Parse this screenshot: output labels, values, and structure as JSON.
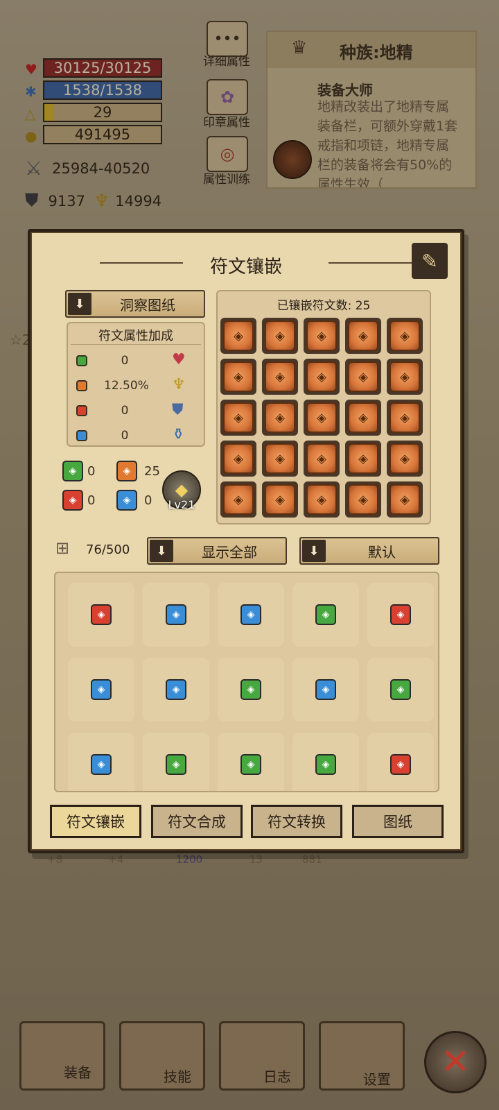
{
  "stats": {
    "hp": "30125/30125",
    "mp": "1538/1538",
    "level": "29",
    "gold": "491495",
    "attack": "25984-40520",
    "defense": "9137",
    "power": "14994"
  },
  "top_buttons": {
    "detail": "详细属性",
    "seal": "印章属性",
    "training": "属性训练"
  },
  "race": {
    "title": "种族:地精",
    "skill_name": "装备大师",
    "desc": "地精改装出了地精专属装备栏，可额外穿戴1套戒指和项链，地精专属栏的装备将会有50%的属性生效（"
  },
  "background_hint": {
    "star": "2"
  },
  "panel": {
    "title": "符文镶嵌",
    "blueprint_dropdown": "洞察图纸",
    "bonus_title": "符文属性加成",
    "bonuses": [
      {
        "color": "#48a840",
        "value": "0",
        "icon": "heart-icon"
      },
      {
        "color": "#e07a30",
        "value": "12.50%",
        "icon": "key-icon"
      },
      {
        "color": "#d84030",
        "value": "0",
        "icon": "shield-icon"
      },
      {
        "color": "#3a8ed8",
        "value": "0",
        "icon": "potion-icon"
      }
    ],
    "counts": {
      "green": "0",
      "orange": "25",
      "red": "0",
      "blue": "0"
    },
    "level": "Lv21",
    "socketed_label": "已镶嵌符文数: 25",
    "bag_count": "76/500",
    "filter_dropdown": "显示全部",
    "sort_dropdown": "默认",
    "inventory": [
      [
        "red",
        "blue",
        "blue",
        "green",
        "red"
      ],
      [
        "blue",
        "blue",
        "green",
        "blue",
        "green"
      ],
      [
        "blue",
        "green",
        "green",
        "green",
        "red"
      ]
    ],
    "tabs": [
      "符文镶嵌",
      "符文合成",
      "符文转换",
      "图纸"
    ]
  },
  "behind_items": [
    "+8",
    "+4",
    "1200",
    "13",
    "881"
  ],
  "nav": [
    "装备",
    "技能",
    "日志",
    "设置"
  ]
}
